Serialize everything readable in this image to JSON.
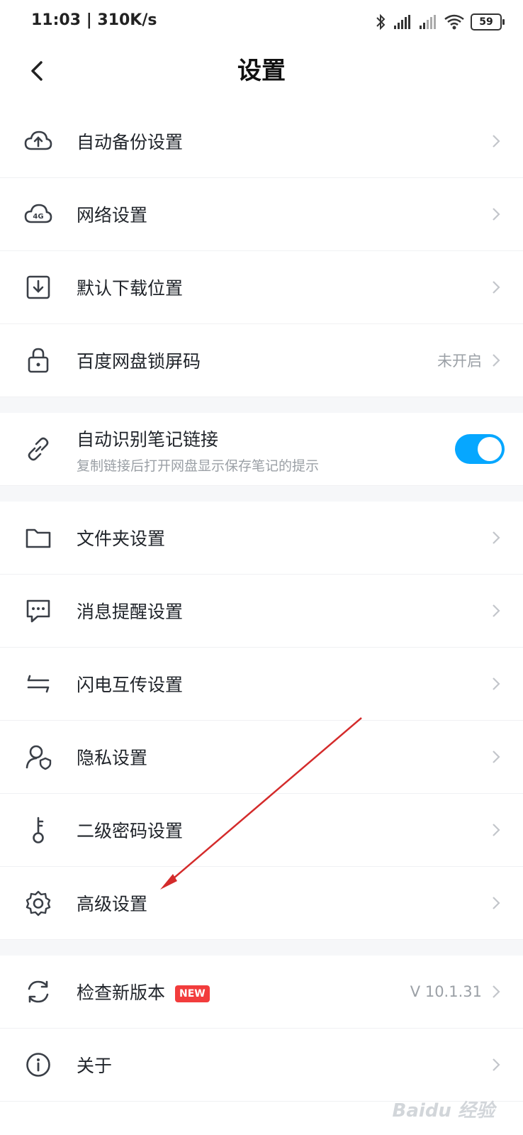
{
  "status": {
    "time_speed": "11:03 | 310K/s",
    "battery": "59"
  },
  "nav": {
    "title": "设置"
  },
  "items": [
    {
      "label": "自动备份设置",
      "icon": "cloud-upload-icon"
    },
    {
      "label": "网络设置",
      "icon": "cloud-4g-icon",
      "icon_text": "4G"
    },
    {
      "label": "默认下载位置",
      "icon": "download-box-icon"
    },
    {
      "label": "百度网盘锁屏码",
      "icon": "lock-icon",
      "value": "未开启"
    },
    {
      "label": "自动识别笔记链接",
      "sub": "复制链接后打开网盘显示保存笔记的提示",
      "icon": "link-icon",
      "toggle_on": true
    },
    {
      "label": "文件夹设置",
      "icon": "folder-icon"
    },
    {
      "label": "消息提醒设置",
      "icon": "message-icon"
    },
    {
      "label": "闪电互传设置",
      "icon": "transfer-arrows-icon"
    },
    {
      "label": "隐私设置",
      "icon": "privacy-person-icon"
    },
    {
      "label": "二级密码设置",
      "icon": "key-icon"
    },
    {
      "label": "高级设置",
      "icon": "gear-icon"
    },
    {
      "label": "检查新版本",
      "icon": "refresh-icon",
      "badge": "NEW",
      "value": "V 10.1.31"
    },
    {
      "label": "关于",
      "icon": "info-icon"
    }
  ],
  "watermark": "Baidu 经验",
  "colors": {
    "accent": "#06a7ff",
    "badge": "#f23c3c",
    "annotation_arrow": "#d42b2b"
  }
}
